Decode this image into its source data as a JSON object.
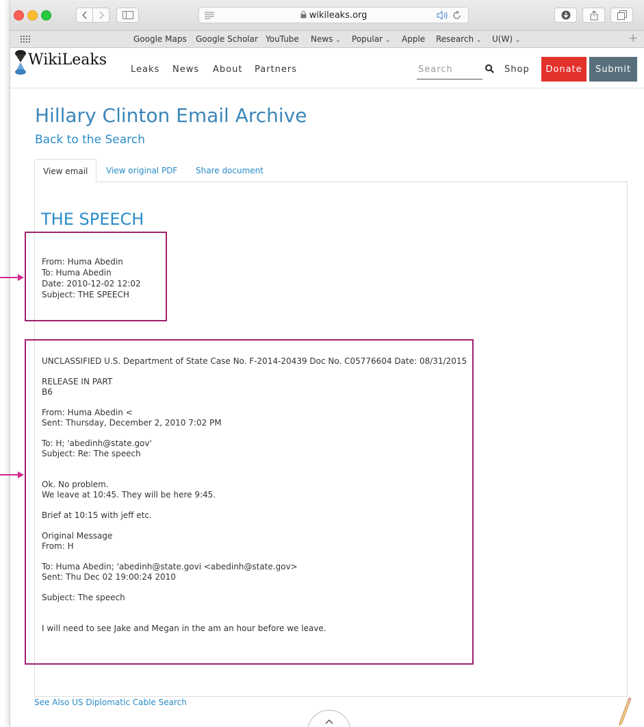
{
  "browser": {
    "url": "wikileaks.org",
    "bookmarks": [
      {
        "label": "Google Maps",
        "has_menu": false
      },
      {
        "label": "Google Scholar",
        "has_menu": false
      },
      {
        "label": "YouTube",
        "has_menu": false
      },
      {
        "label": "News",
        "has_menu": true
      },
      {
        "label": "Popular",
        "has_menu": true
      },
      {
        "label": "Apple",
        "has_menu": false
      },
      {
        "label": "Research",
        "has_menu": true
      },
      {
        "label": "U(W)",
        "has_menu": true
      }
    ],
    "colors": {
      "close": "#fc5f57",
      "minimize": "#fdbb2e",
      "zoom": "#27c840"
    }
  },
  "site": {
    "logo": "WikiLeaks",
    "nav": [
      "Leaks",
      "News",
      "About",
      "Partners"
    ],
    "search_placeholder": "Search",
    "shop": "Shop",
    "donate": "Donate",
    "submit": "Submit",
    "colors": {
      "donate": "#e3312c",
      "submit": "#58707b",
      "link": "#2a8bc9"
    }
  },
  "page": {
    "title": "Hillary Clinton Email Archive",
    "back_link": "Back to the Search",
    "tabs": [
      "View email",
      "View original PDF",
      "Share document"
    ],
    "active_tab": "View email"
  },
  "email": {
    "title": "THE SPEECH",
    "meta": {
      "from": "From: Huma Abedin",
      "to": "To: Huma Abedin",
      "date": "Date: 2010-12-02 12:02",
      "subject": "Subject: THE SPEECH"
    },
    "body": [
      "UNCLASSIFIED U.S. Department of State Case No. F-2014-20439 Doc No. C05776604 Date: 08/31/2015",
      "",
      "RELEASE IN PART",
      "B6",
      "",
      "From: Huma Abedin <",
      "Sent: Thursday, December 2, 2010 7:02 PM",
      "",
      "To: H; 'abedinh@state.gov'",
      "Subject: Re: The speech",
      "",
      "",
      "Ok. No problem.",
      "We leave at 10:45. They will be here 9:45.",
      "",
      "Brief at 10:15 with jeff etc.",
      "",
      "Original Message",
      "From: H",
      "",
      "To: Huma Abedin; 'abedinh@state.govi <abedinh@state.gov>",
      "Sent: Thu Dec 02 19:00:24 2010",
      "",
      "Subject: The speech",
      "",
      "",
      "I will need to see Jake and Megan in the am an hour before we leave."
    ]
  },
  "footer": {
    "see_also": "See Also US Diplomatic Cable Search"
  },
  "annotation_color": "#a0206e"
}
